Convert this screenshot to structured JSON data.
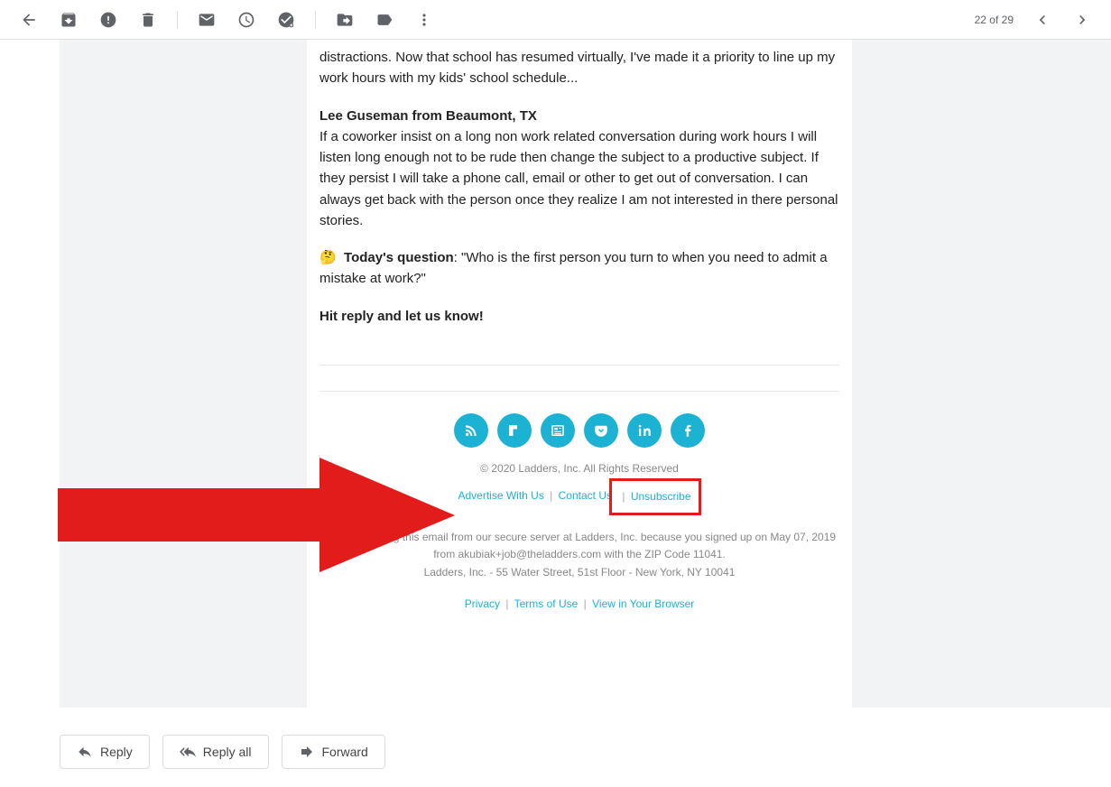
{
  "pager": {
    "text": "22 of 29"
  },
  "message": {
    "intro_fragment": "distractions. Now that school has resumed virtually, I've made it a priority to line up my work hours with my kids' school schedule...",
    "author_line": "Lee Guseman from Beaumont, TX",
    "author_body": "If a coworker insist on a long non work related conversation during work hours I will listen long enough not to be rude then change the subject to a productive subject. If they persist I will take a phone call, email or other to get out of conversation. I can always get back with the person once they realize I am not interested in there personal stories.",
    "question_emoji": "🤔",
    "question_label": "Today's question",
    "question_body": ": \"Who is the first person you turn to when you need to admit a mistake at work?\"",
    "cta": "Hit reply and let us know!"
  },
  "footer": {
    "copyright": "© 2020 Ladders, Inc. All Rights Reserved",
    "links1": {
      "advertise": "Advertise With Us",
      "contact": "Contact Us",
      "unsub": "Unsubscribe"
    },
    "disclosure1": "You're receiving this email from our secure server at Ladders, Inc. because you signed up on May 07, 2019 from akubiak+job@theladders.com with the ZIP Code 11041.",
    "disclosure2": "Ladders, Inc. - 55 Water Street, 51st Floor - New York, NY 10041",
    "links2": {
      "privacy": "Privacy",
      "terms": "Terms of Use",
      "view": "View in Your Browser"
    }
  },
  "actions": {
    "reply": "Reply",
    "replyall": "Reply all",
    "forward": "Forward"
  }
}
